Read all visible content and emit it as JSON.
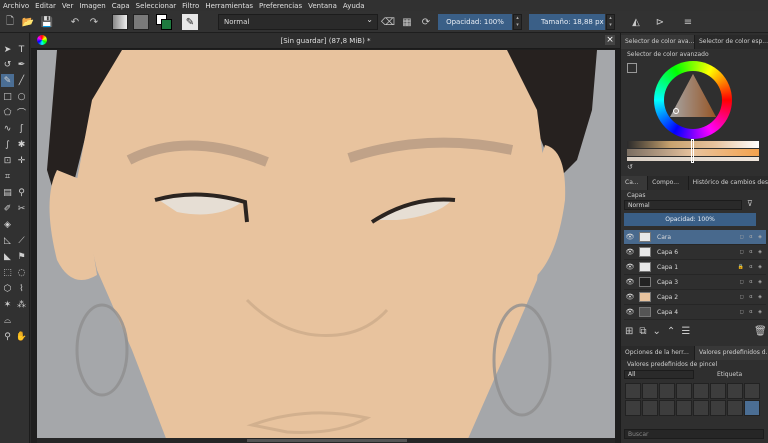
{
  "menu": [
    "Archivo",
    "Editar",
    "Ver",
    "Imagen",
    "Capa",
    "Seleccionar",
    "Filtro",
    "Herramientas",
    "Preferencias",
    "Ventana",
    "Ayuda"
  ],
  "toolbar": {
    "blend_mode": "Normal",
    "opacity": "Opacidad: 100%",
    "size": "Tamaño: 18,88 px"
  },
  "document": {
    "title": "[Sin guardar]  (87,8 MiB) *"
  },
  "docker": {
    "color_tabs": [
      "Selector de color ava...",
      "Selector de color esp..."
    ],
    "color_selector_title": "Selector de color avanzado",
    "layer_tabs": [
      "Ca...",
      "Compo...",
      "Histórico de cambios des..."
    ],
    "layers_title": "Capas",
    "layer_blend": "Normal",
    "layer_opacity": "Opacidad:  100%",
    "layers": [
      {
        "name": "Cara",
        "selected": true,
        "locked": false
      },
      {
        "name": "Capa 6",
        "selected": false,
        "locked": false
      },
      {
        "name": "Capa 1",
        "selected": false,
        "locked": true
      },
      {
        "name": "Capa 3",
        "selected": false,
        "locked": false
      },
      {
        "name": "Capa 2",
        "selected": false,
        "locked": false
      },
      {
        "name": "Capa 4",
        "selected": false,
        "locked": false
      }
    ],
    "bottom_tabs": [
      "Opciones de la herr...",
      "Valores predefinidos d..."
    ],
    "presets_title": "Valores predefinidos de pincel",
    "presets_filter": "All",
    "presets_tag": "Etiqueta",
    "search_placeholder": "Buscar"
  },
  "colors": {
    "accent": "#3a5f87",
    "skin": "#e8c39e",
    "background_gray": "#a5a7aa",
    "hair": "#26211f"
  }
}
